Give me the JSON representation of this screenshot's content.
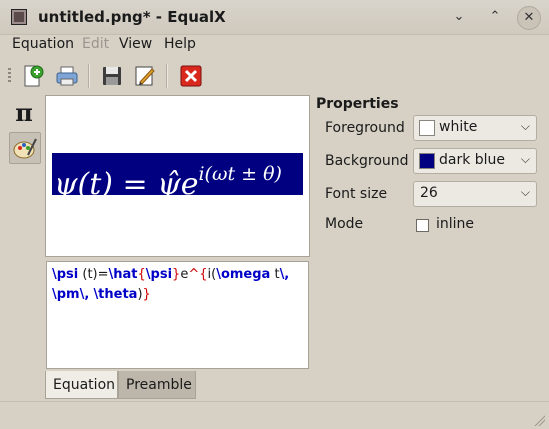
{
  "window": {
    "title": "untitled.png* - EqualX"
  },
  "title_buttons": {
    "minimize": "⌄",
    "maximize": "⌃",
    "close": "✕"
  },
  "menu": {
    "equation": "Equation",
    "edit": "Edit",
    "view": "View",
    "help": "Help"
  },
  "toolbar": {
    "icons": [
      "new-document-icon",
      "print-icon",
      "save-icon",
      "edit-icon",
      "close-icon"
    ]
  },
  "symbols": {
    "pi": "π"
  },
  "preview": {
    "base": "ψ(t) = ψ̂e",
    "exponent": "i(ωt ± θ)",
    "background": "#000080",
    "foreground": "#ffffff"
  },
  "editor": {
    "line1": [
      {
        "t": "\\psi",
        "k": "cmd"
      },
      {
        "t": " (t)=",
        "k": "plain"
      },
      {
        "t": "\\hat",
        "k": "cmd"
      },
      {
        "t": "{",
        "k": "brace"
      },
      {
        "t": "\\psi",
        "k": "cmd"
      },
      {
        "t": "}",
        "k": "brace"
      },
      {
        "t": "e",
        "k": "plain"
      },
      {
        "t": "^",
        "k": "brace"
      },
      {
        "t": "{",
        "k": "brace"
      },
      {
        "t": "i(",
        "k": "plain"
      },
      {
        "t": "\\omega",
        "k": "cmd"
      },
      {
        "t": " t",
        "k": "plain"
      },
      {
        "t": "\\,",
        "k": "cmd"
      }
    ],
    "line2": [
      {
        "t": "\\pm",
        "k": "cmd"
      },
      {
        "t": "\\,",
        "k": "cmd"
      },
      {
        "t": " ",
        "k": "plain"
      },
      {
        "t": "\\theta",
        "k": "cmd"
      },
      {
        "t": ")",
        "k": "plain"
      },
      {
        "t": "}",
        "k": "brace"
      }
    ]
  },
  "tabs": {
    "equation": "Equation",
    "preamble": "Preamble"
  },
  "properties": {
    "title": "Properties",
    "foreground_label": "Foreground",
    "foreground_value": "white",
    "foreground_color": "#ffffff",
    "background_label": "Background",
    "background_value": "dark blue",
    "background_color": "#000080",
    "font_size_label": "Font size",
    "font_size_value": "26",
    "mode_label": "Mode",
    "mode_option": "inline",
    "mode_checked": false
  }
}
